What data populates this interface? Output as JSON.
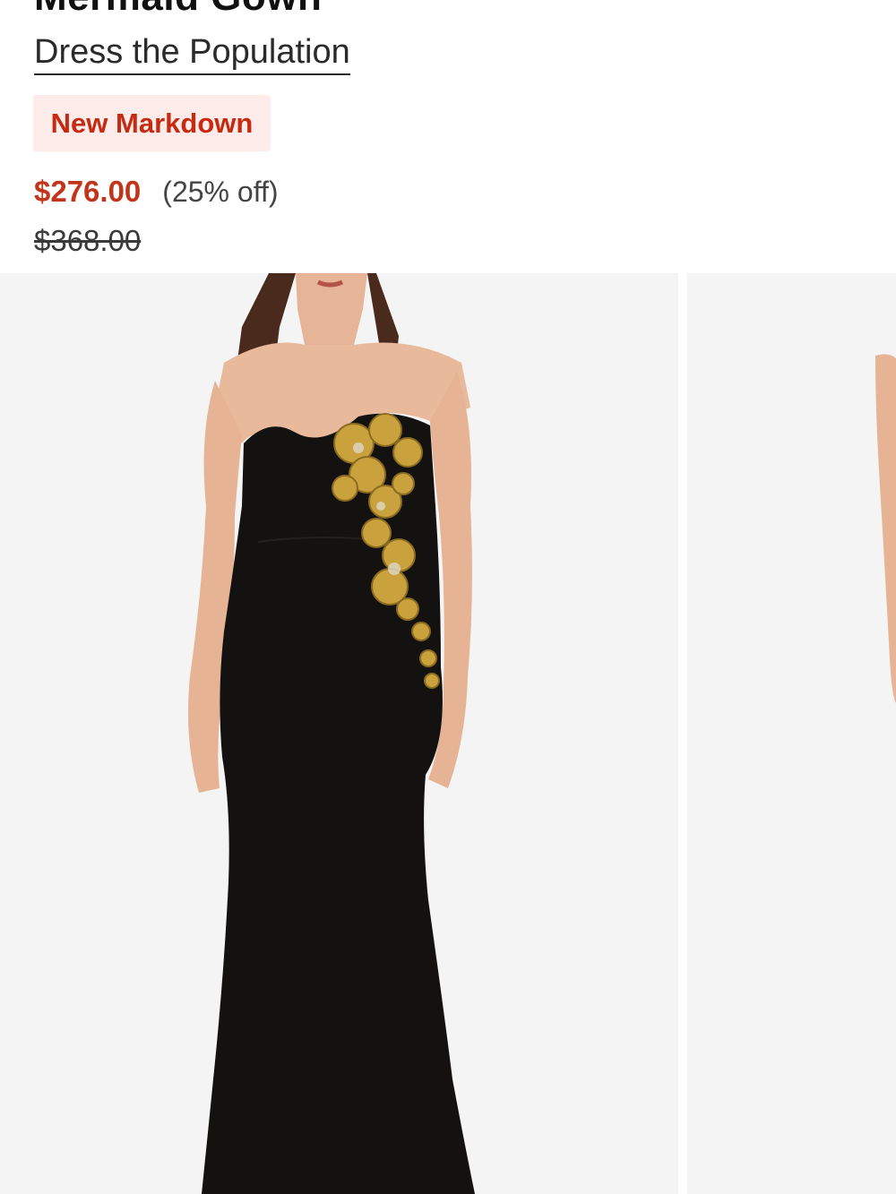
{
  "product": {
    "title": "Mermaid Gown",
    "brand": "Dress the Population",
    "badge": "New Markdown",
    "sale_price": "$276.00",
    "discount": "(25% off)",
    "original_price": "$368.00"
  },
  "colors": {
    "sale": "#c1361b",
    "badge_bg": "#fdecea",
    "badge_text": "#c62b12",
    "image_bg": "#f4f4f4",
    "gown": "#141210",
    "sequin_gold": "#c9a23e"
  },
  "gallery": {
    "images": [
      {
        "description_icon": "product-photo-front"
      },
      {
        "description_icon": "product-photo-next"
      }
    ]
  }
}
